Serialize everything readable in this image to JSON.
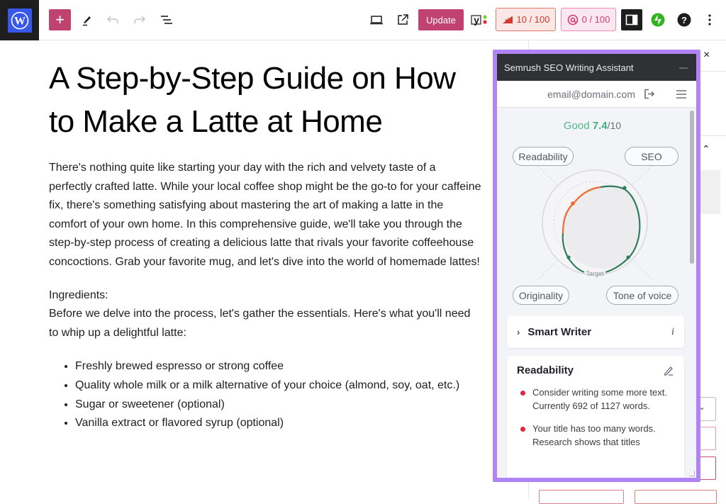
{
  "toolbar": {
    "add_label": "+",
    "update_label": "Update",
    "seo_score": "10 / 100",
    "readability_score": "0 / 100",
    "icons": [
      "wordpress-logo-icon",
      "plus-icon",
      "pencil-icon",
      "undo-icon",
      "redo-icon",
      "document-overview-icon",
      "desktop-preview-icon",
      "external-link-icon",
      "yoast-icon",
      "seo-chart-icon",
      "readability-at-icon",
      "sidebar-toggle-icon",
      "jetpack-bolt-icon",
      "help-icon",
      "more-options-icon"
    ]
  },
  "post": {
    "title": "A Step-by-Step Guide on How to Make a Latte at Home",
    "intro": "There's nothing quite like starting your day with the rich and velvety taste of a perfectly crafted latte. While your local coffee shop might be the go-to for your caffeine fix, there's something satisfying about mastering the art of making a latte in the comfort of your own home. In this comprehensive guide, we'll take you through the step-by-step process of creating a delicious latte that rivals your favorite coffeehouse concoctions. Grab your favorite mug, and let's dive into the world of homemade lattes!",
    "ingredients_heading": "Ingredients:",
    "ingredients_intro": "Before we delve into the process, let's gather the essentials. Here's what you'll need to whip up a delightful latte:",
    "ingredients": [
      "Freshly brewed espresso or strong coffee",
      "Quality whole milk or a milk alternative of your choice (almond, soy, oat, etc.)",
      "Sugar or sweetener (optional)",
      "Vanilla extract or flavored syrup (optional)"
    ]
  },
  "settings_panel": {
    "close_label": "×",
    "collapse_label": "^"
  },
  "semrush": {
    "title": "Semrush SEO Writing Assistant",
    "minimize_label": "—",
    "email": "email@domain.com",
    "score": {
      "label": "Good",
      "value": "7.4",
      "max": "/10"
    },
    "chart": {
      "axes": [
        "Readability",
        "SEO",
        "Originality",
        "Tone of voice"
      ],
      "target_label": "Target",
      "colors": {
        "good": "#2e7d5b",
        "warning": "#f26a2e"
      }
    },
    "smart_writer": {
      "label": "Smart Writer",
      "info_label": "i"
    },
    "readability": {
      "title": "Readability",
      "items": [
        "Consider writing some more text. Currently 692 of 1127 words.",
        "Your title has too many words. Research shows that titles"
      ]
    }
  },
  "colors": {
    "wp_accent": "#c0426e",
    "wp_blue": "#3858e9",
    "semrush_frame": "#b084f5",
    "score_green": "#3fae7f"
  }
}
